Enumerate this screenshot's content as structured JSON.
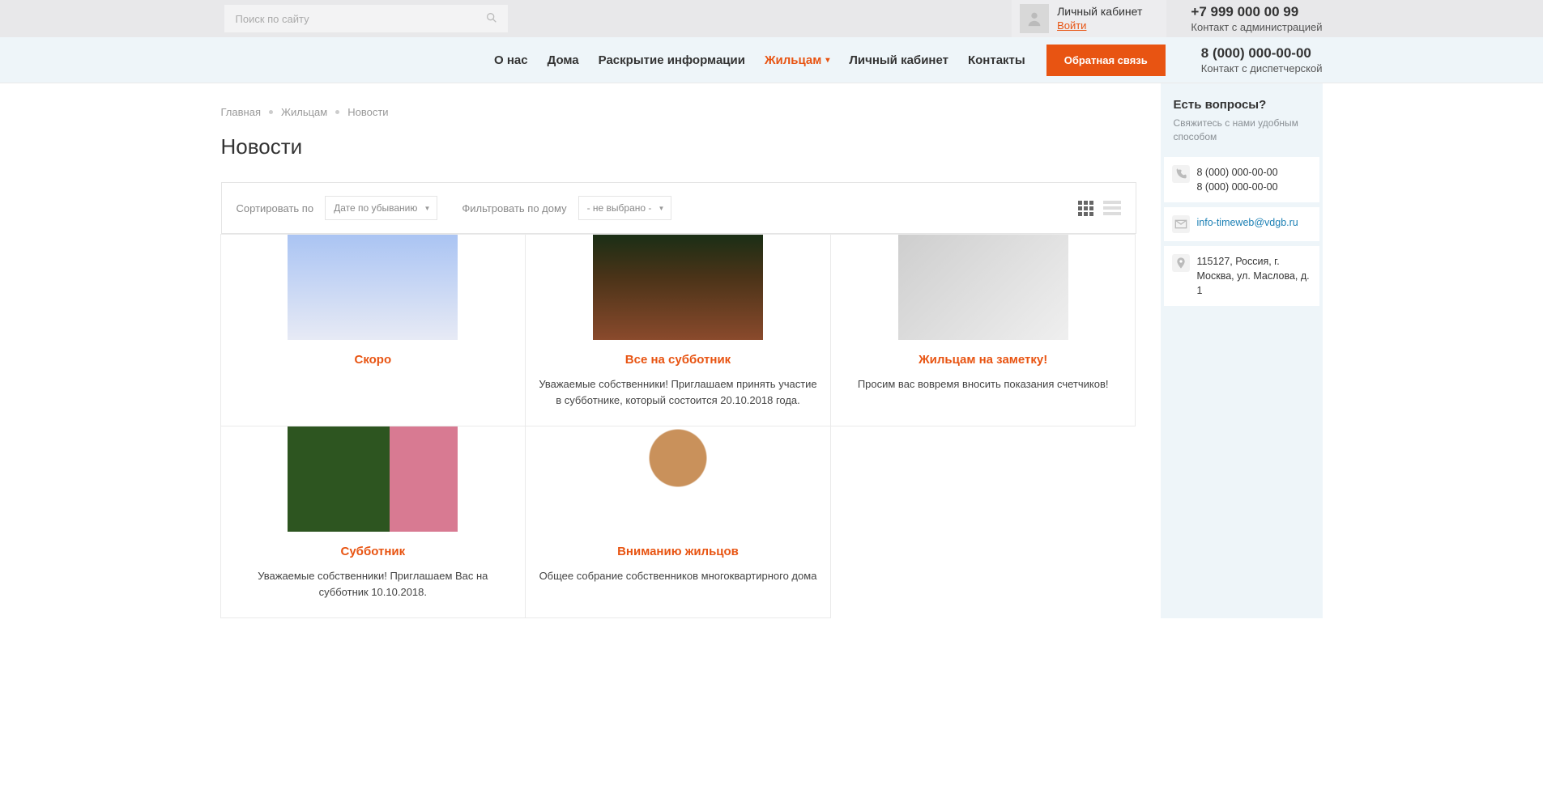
{
  "topbar": {
    "search_placeholder": "Поиск по сайту",
    "account_title": "Личный кабинет",
    "account_login": "Войти",
    "phone": "+7 999 000 00 99",
    "phone_sub": "Контакт с администрацией"
  },
  "nav": {
    "items": [
      "О нас",
      "Дома",
      "Раскрытие информации",
      "Жильцам",
      "Личный кабинет",
      "Контакты"
    ],
    "active_index": 3,
    "feedback_label": "Обратная связь",
    "dispatch_phone": "8 (000) 000-00-00",
    "dispatch_sub": "Контакт с диспетчерской"
  },
  "breadcrumbs": [
    "Главная",
    "Жильцам",
    "Новости"
  ],
  "page_title": "Новости",
  "filter": {
    "sort_label": "Сортировать по",
    "sort_value": "Дате по убыванию",
    "filter_label": "Фильтровать по дому",
    "filter_value": "- не выбрано -"
  },
  "news": [
    {
      "title": "Скоро",
      "desc": ""
    },
    {
      "title": "Все на субботник",
      "desc": "Уважаемые собственники! Приглашаем принять участие в субботнике, который состоится 20.10.2018 года."
    },
    {
      "title": "Жильцам на заметку!",
      "desc": "Просим вас вовремя вносить показания счетчиков!"
    },
    {
      "title": "Субботник",
      "desc": "Уважаемые собственники! Приглашаем Вас на субботник 10.10.2018."
    },
    {
      "title": "Вниманию жильцов",
      "desc": "Общее собрание собственников многоквартирного дома"
    }
  ],
  "sidebar": {
    "title": "Есть вопросы?",
    "sub": "Свяжитесь с нами удобным способом",
    "phone1": "8 (000) 000-00-00",
    "phone2": "8 (000) 000-00-00",
    "email": "info-timeweb@vdgb.ru",
    "address": "115127, Россия, г. Москва, ул. Маслова, д. 1"
  }
}
